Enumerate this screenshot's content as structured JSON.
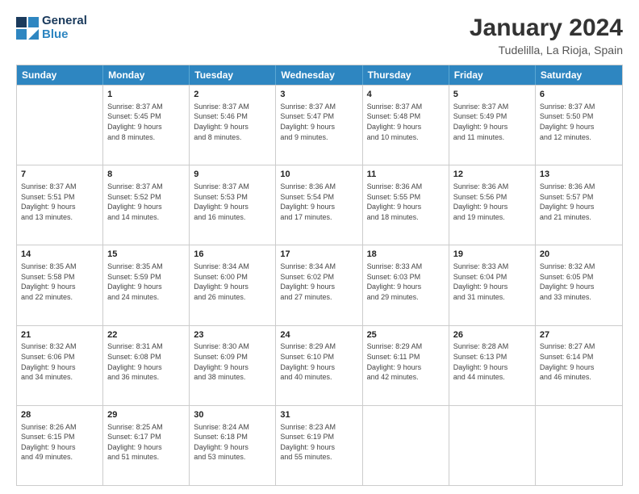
{
  "header": {
    "logo_line1": "General",
    "logo_line2": "Blue",
    "title": "January 2024",
    "location": "Tudelilla, La Rioja, Spain"
  },
  "weekdays": [
    "Sunday",
    "Monday",
    "Tuesday",
    "Wednesday",
    "Thursday",
    "Friday",
    "Saturday"
  ],
  "weeks": [
    [
      {
        "day": "",
        "info": ""
      },
      {
        "day": "1",
        "info": "Sunrise: 8:37 AM\nSunset: 5:45 PM\nDaylight: 9 hours\nand 8 minutes."
      },
      {
        "day": "2",
        "info": "Sunrise: 8:37 AM\nSunset: 5:46 PM\nDaylight: 9 hours\nand 8 minutes."
      },
      {
        "day": "3",
        "info": "Sunrise: 8:37 AM\nSunset: 5:47 PM\nDaylight: 9 hours\nand 9 minutes."
      },
      {
        "day": "4",
        "info": "Sunrise: 8:37 AM\nSunset: 5:48 PM\nDaylight: 9 hours\nand 10 minutes."
      },
      {
        "day": "5",
        "info": "Sunrise: 8:37 AM\nSunset: 5:49 PM\nDaylight: 9 hours\nand 11 minutes."
      },
      {
        "day": "6",
        "info": "Sunrise: 8:37 AM\nSunset: 5:50 PM\nDaylight: 9 hours\nand 12 minutes."
      }
    ],
    [
      {
        "day": "7",
        "info": "Sunrise: 8:37 AM\nSunset: 5:51 PM\nDaylight: 9 hours\nand 13 minutes."
      },
      {
        "day": "8",
        "info": "Sunrise: 8:37 AM\nSunset: 5:52 PM\nDaylight: 9 hours\nand 14 minutes."
      },
      {
        "day": "9",
        "info": "Sunrise: 8:37 AM\nSunset: 5:53 PM\nDaylight: 9 hours\nand 16 minutes."
      },
      {
        "day": "10",
        "info": "Sunrise: 8:36 AM\nSunset: 5:54 PM\nDaylight: 9 hours\nand 17 minutes."
      },
      {
        "day": "11",
        "info": "Sunrise: 8:36 AM\nSunset: 5:55 PM\nDaylight: 9 hours\nand 18 minutes."
      },
      {
        "day": "12",
        "info": "Sunrise: 8:36 AM\nSunset: 5:56 PM\nDaylight: 9 hours\nand 19 minutes."
      },
      {
        "day": "13",
        "info": "Sunrise: 8:36 AM\nSunset: 5:57 PM\nDaylight: 9 hours\nand 21 minutes."
      }
    ],
    [
      {
        "day": "14",
        "info": "Sunrise: 8:35 AM\nSunset: 5:58 PM\nDaylight: 9 hours\nand 22 minutes."
      },
      {
        "day": "15",
        "info": "Sunrise: 8:35 AM\nSunset: 5:59 PM\nDaylight: 9 hours\nand 24 minutes."
      },
      {
        "day": "16",
        "info": "Sunrise: 8:34 AM\nSunset: 6:00 PM\nDaylight: 9 hours\nand 26 minutes."
      },
      {
        "day": "17",
        "info": "Sunrise: 8:34 AM\nSunset: 6:02 PM\nDaylight: 9 hours\nand 27 minutes."
      },
      {
        "day": "18",
        "info": "Sunrise: 8:33 AM\nSunset: 6:03 PM\nDaylight: 9 hours\nand 29 minutes."
      },
      {
        "day": "19",
        "info": "Sunrise: 8:33 AM\nSunset: 6:04 PM\nDaylight: 9 hours\nand 31 minutes."
      },
      {
        "day": "20",
        "info": "Sunrise: 8:32 AM\nSunset: 6:05 PM\nDaylight: 9 hours\nand 33 minutes."
      }
    ],
    [
      {
        "day": "21",
        "info": "Sunrise: 8:32 AM\nSunset: 6:06 PM\nDaylight: 9 hours\nand 34 minutes."
      },
      {
        "day": "22",
        "info": "Sunrise: 8:31 AM\nSunset: 6:08 PM\nDaylight: 9 hours\nand 36 minutes."
      },
      {
        "day": "23",
        "info": "Sunrise: 8:30 AM\nSunset: 6:09 PM\nDaylight: 9 hours\nand 38 minutes."
      },
      {
        "day": "24",
        "info": "Sunrise: 8:29 AM\nSunset: 6:10 PM\nDaylight: 9 hours\nand 40 minutes."
      },
      {
        "day": "25",
        "info": "Sunrise: 8:29 AM\nSunset: 6:11 PM\nDaylight: 9 hours\nand 42 minutes."
      },
      {
        "day": "26",
        "info": "Sunrise: 8:28 AM\nSunset: 6:13 PM\nDaylight: 9 hours\nand 44 minutes."
      },
      {
        "day": "27",
        "info": "Sunrise: 8:27 AM\nSunset: 6:14 PM\nDaylight: 9 hours\nand 46 minutes."
      }
    ],
    [
      {
        "day": "28",
        "info": "Sunrise: 8:26 AM\nSunset: 6:15 PM\nDaylight: 9 hours\nand 49 minutes."
      },
      {
        "day": "29",
        "info": "Sunrise: 8:25 AM\nSunset: 6:17 PM\nDaylight: 9 hours\nand 51 minutes."
      },
      {
        "day": "30",
        "info": "Sunrise: 8:24 AM\nSunset: 6:18 PM\nDaylight: 9 hours\nand 53 minutes."
      },
      {
        "day": "31",
        "info": "Sunrise: 8:23 AM\nSunset: 6:19 PM\nDaylight: 9 hours\nand 55 minutes."
      },
      {
        "day": "",
        "info": ""
      },
      {
        "day": "",
        "info": ""
      },
      {
        "day": "",
        "info": ""
      }
    ]
  ]
}
